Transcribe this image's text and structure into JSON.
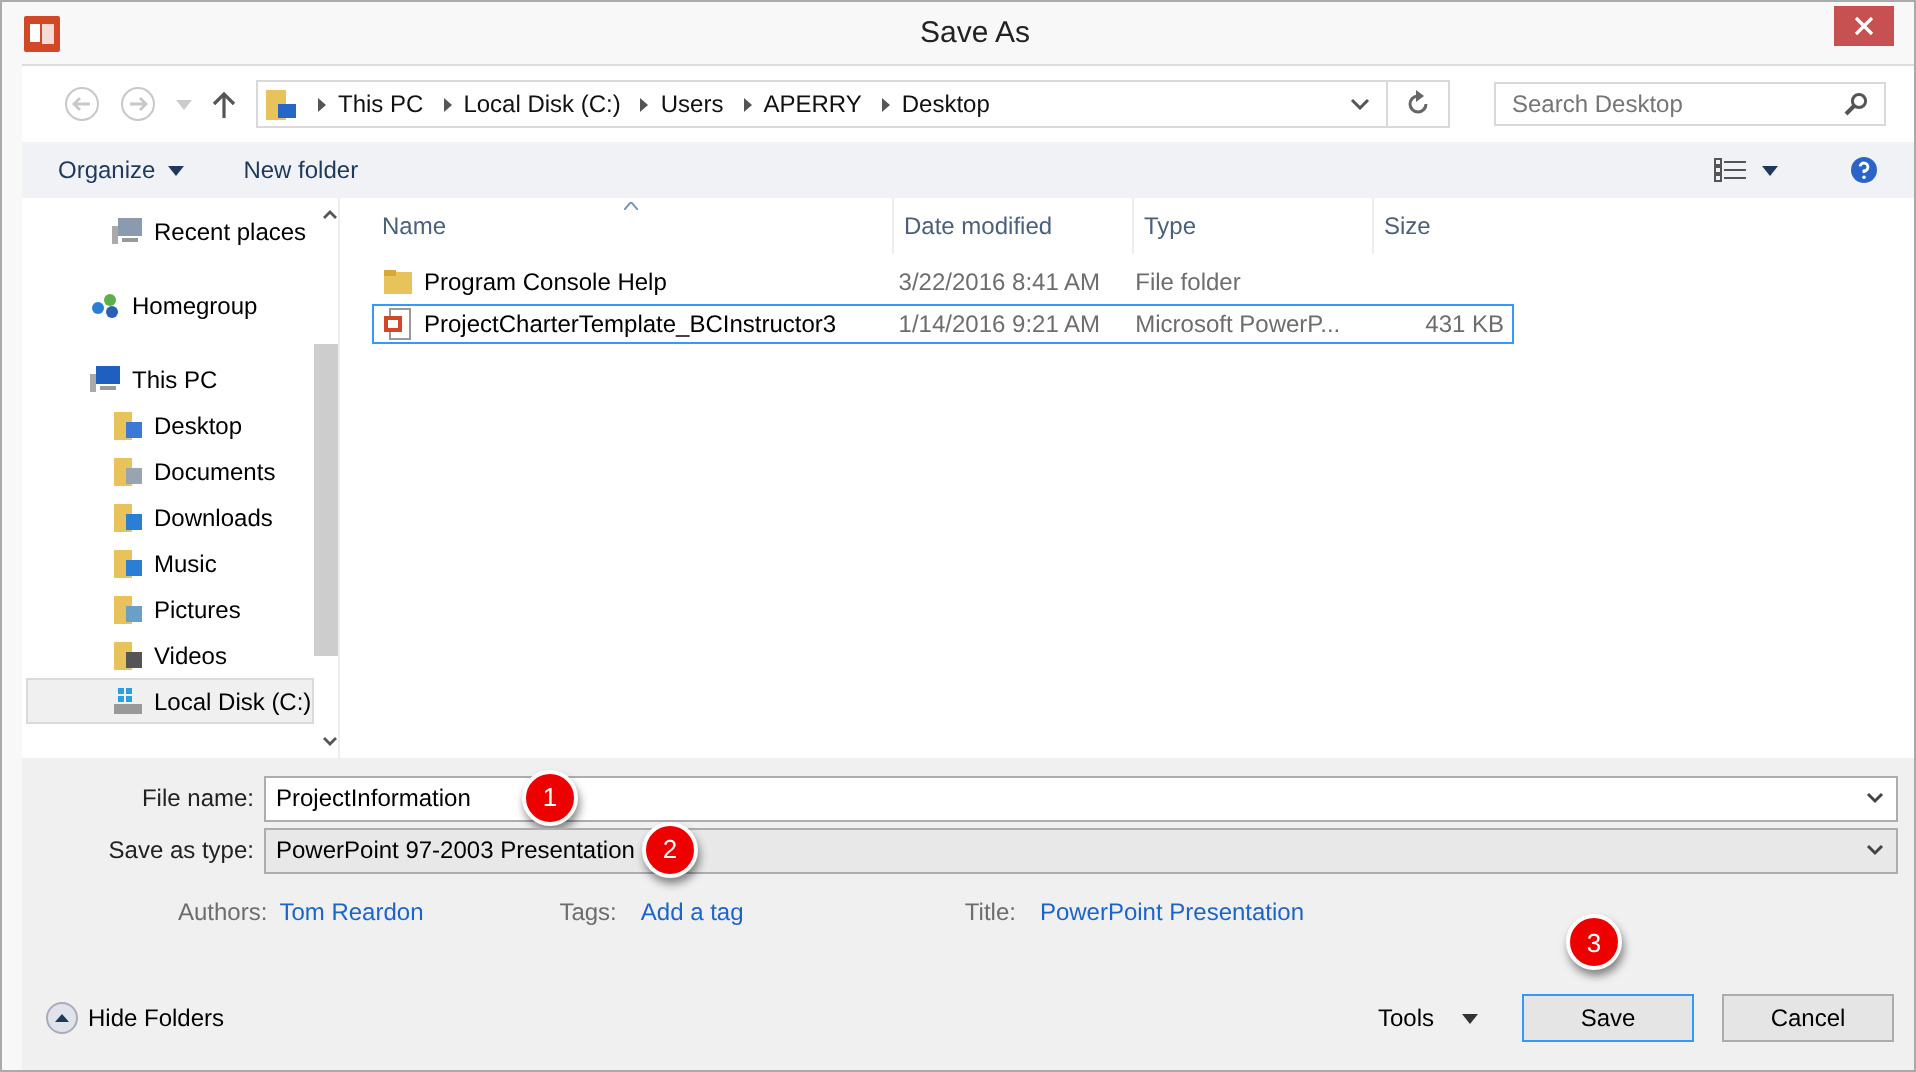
{
  "window": {
    "title": "Save As"
  },
  "address_bar": {
    "path": [
      "This PC",
      "Local Disk (C:)",
      "Users",
      "APERRY",
      "Desktop"
    ]
  },
  "search": {
    "placeholder": "Search Desktop"
  },
  "toolbar": {
    "organize": "Organize",
    "new_folder": "New folder"
  },
  "sidebar": {
    "items": [
      {
        "label": "Recent places",
        "kind": "recent",
        "selected": false
      },
      {
        "label": "Homegroup",
        "kind": "homegroup",
        "selected": false
      },
      {
        "label": "This PC",
        "kind": "pc",
        "selected": false,
        "children": [
          {
            "label": "Desktop",
            "kind": "desktop",
            "selected": false
          },
          {
            "label": "Documents",
            "kind": "documents",
            "selected": false
          },
          {
            "label": "Downloads",
            "kind": "downloads",
            "selected": false
          },
          {
            "label": "Music",
            "kind": "music",
            "selected": false
          },
          {
            "label": "Pictures",
            "kind": "pictures",
            "selected": false
          },
          {
            "label": "Videos",
            "kind": "videos",
            "selected": false
          },
          {
            "label": "Local Disk (C:)",
            "kind": "disk",
            "selected": true
          }
        ]
      }
    ]
  },
  "table": {
    "columns": [
      "Name",
      "Date modified",
      "Type",
      "Size"
    ],
    "rows": [
      {
        "kind": "folder",
        "name": "Program Console Help",
        "date": "3/22/2016 8:41 AM",
        "type": "File folder",
        "size": "",
        "selected": false
      },
      {
        "kind": "presentation",
        "name": "ProjectCharterTemplate_BCInstructor3",
        "date": "1/14/2016 9:21 AM",
        "type": "Microsoft PowerP...",
        "size": "431 KB",
        "selected": true
      }
    ]
  },
  "form": {
    "file_name_label": "File name:",
    "file_name": "ProjectInformation",
    "type_label": "Save as type:",
    "type": "PowerPoint 97-2003 Presentation",
    "authors_label": "Authors:",
    "authors": "Tom Reardon",
    "tags_label": "Tags:",
    "tags": "Add a tag",
    "title_label": "Title:",
    "title": "PowerPoint Presentation"
  },
  "footer": {
    "hide_folders": "Hide Folders",
    "tools": "Tools",
    "save": "Save",
    "cancel": "Cancel"
  },
  "callouts": [
    "1",
    "2",
    "3"
  ]
}
